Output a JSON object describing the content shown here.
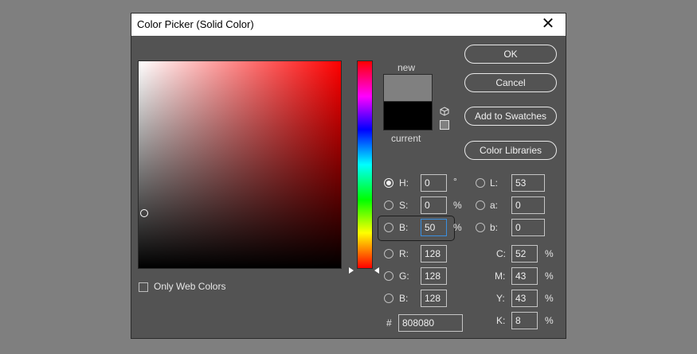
{
  "window": {
    "title": "Color Picker (Solid Color)",
    "close_symbol": "✕"
  },
  "preview": {
    "new_label": "new",
    "current_label": "current",
    "new_color": "#808080",
    "current_color": "#000000"
  },
  "buttons": {
    "ok": "OK",
    "cancel": "Cancel",
    "add_to_swatches": "Add to Swatches",
    "color_libraries": "Color Libraries"
  },
  "hsb": [
    {
      "label": "H:",
      "value": "0",
      "unit": "°",
      "checked": true
    },
    {
      "label": "S:",
      "value": "0",
      "unit": "%",
      "checked": false
    },
    {
      "label": "B:",
      "value": "50",
      "unit": "%",
      "checked": false
    }
  ],
  "rgb": [
    {
      "label": "R:",
      "value": "128"
    },
    {
      "label": "G:",
      "value": "128"
    },
    {
      "label": "B:",
      "value": "128"
    }
  ],
  "lab": [
    {
      "label": "L:",
      "value": "53"
    },
    {
      "label": "a:",
      "value": "0"
    },
    {
      "label": "b:",
      "value": "0"
    }
  ],
  "cmyk": [
    {
      "label": "C:",
      "value": "52",
      "unit": "%"
    },
    {
      "label": "M:",
      "value": "43",
      "unit": "%"
    },
    {
      "label": "Y:",
      "value": "43",
      "unit": "%"
    },
    {
      "label": "K:",
      "value": "8",
      "unit": "%"
    }
  ],
  "hex": {
    "label": "#",
    "value": "808080"
  },
  "web_colors": {
    "label": "Only Web Colors",
    "checked": false
  },
  "colors": {
    "background": "#7f7f7f",
    "dialog": "#535353",
    "accent": "#3a8fe0"
  }
}
